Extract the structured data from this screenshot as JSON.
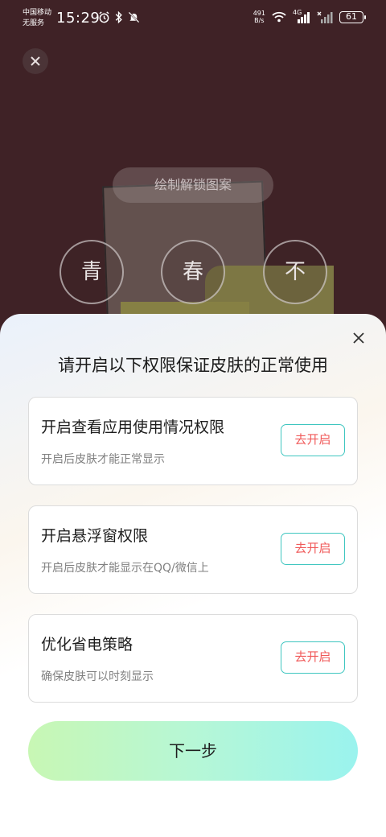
{
  "status_bar": {
    "carrier_line1": "中国移动",
    "carrier_line2": "无服务",
    "time": "15:29",
    "net_speed_value": "491",
    "net_speed_unit": "B/s",
    "network_type": "4G",
    "battery": "61"
  },
  "lock_preview": {
    "hint": "绘制解锁图案",
    "dots": [
      "青",
      "春",
      "不"
    ]
  },
  "sheet": {
    "title": "请开启以下权限保证皮肤的正常使用",
    "permissions": [
      {
        "title": "开启查看应用使用情况权限",
        "desc": "开启后皮肤才能正常显示",
        "button": "去开启"
      },
      {
        "title": "开启悬浮窗权限",
        "desc": "开启后皮肤才能显示在QQ/微信上",
        "button": "去开启"
      },
      {
        "title": "优化省电策略",
        "desc": "确保皮肤可以时刻显示",
        "button": "去开启"
      }
    ],
    "next_button": "下一步"
  },
  "colors": {
    "background": "#3f2226",
    "accent_border": "#3fc6c0",
    "button_text": "#f05a5a"
  }
}
